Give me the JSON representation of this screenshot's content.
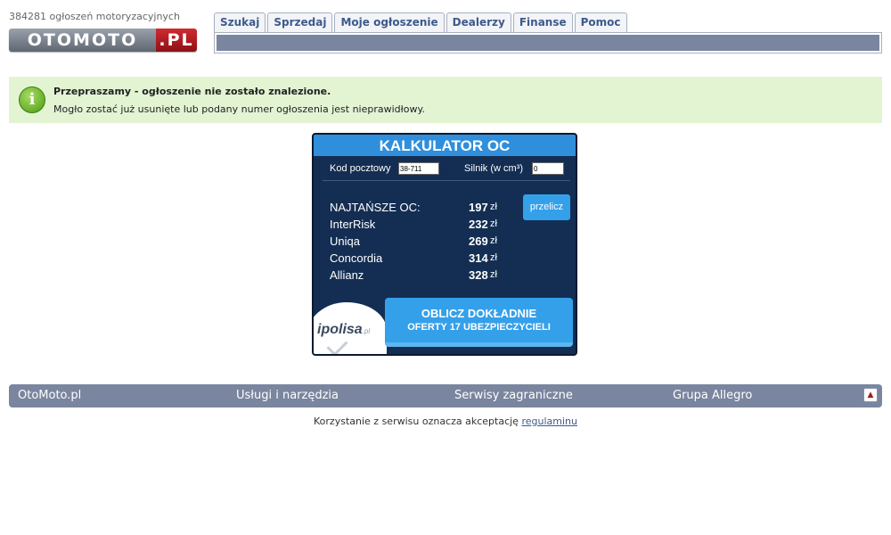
{
  "header": {
    "count_text": "384281 ogłoszeń motoryzacyjnych",
    "logo_left": "OTOMOTO",
    "logo_right": ".PL"
  },
  "nav": {
    "tabs": [
      "Szukaj",
      "Sprzedaj",
      "Moje ogłoszenie",
      "Dealerzy",
      "Finanse",
      "Pomoc"
    ]
  },
  "notice": {
    "icon": "info-icon",
    "title": "Przepraszamy - ogłoszenie nie zostało znalezione.",
    "text": "Mogło zostać już usunięte lub podany numer ogłoszenia jest nieprawidłowy."
  },
  "calculator": {
    "title": "KALKULATOR OC",
    "postal_label": "Kod pocztowy",
    "postal_value": "38-711",
    "engine_label": "Silnik (w cm³)",
    "engine_value": "0",
    "recalc_label": "przelicz",
    "rows": [
      {
        "name": "NAJTAŃSZE OC:",
        "value": "197",
        "currency": "zł"
      },
      {
        "name": "InterRisk",
        "value": "232",
        "currency": "zł"
      },
      {
        "name": "Uniqa",
        "value": "269",
        "currency": "zł"
      },
      {
        "name": "Concordia",
        "value": "314",
        "currency": "zł"
      },
      {
        "name": "Allianz",
        "value": "328",
        "currency": "zł"
      }
    ],
    "partner_logo": "ipolisa",
    "partner_logo_suffix": ".pl",
    "cta_line1": "OBLICZ DOKŁADNIE",
    "cta_line2": "OFERTY 17 UBEZPIECZYCIELI"
  },
  "footer": {
    "items": [
      "OtoMoto.pl",
      "Usługi i narzędzia",
      "Serwisy zagraniczne",
      "Grupa Allegro"
    ],
    "up_icon": "arrow-up-icon",
    "terms_text": "Korzystanie z serwisu oznacza akceptację",
    "terms_link": "regulaminu"
  },
  "colors": {
    "nav_bar": "#7a859f",
    "notice_bg": "#e3f4d3",
    "calc_bg": "#142e53",
    "calc_accent": "#35a0ea",
    "logo_red": "#cf2a2f"
  }
}
